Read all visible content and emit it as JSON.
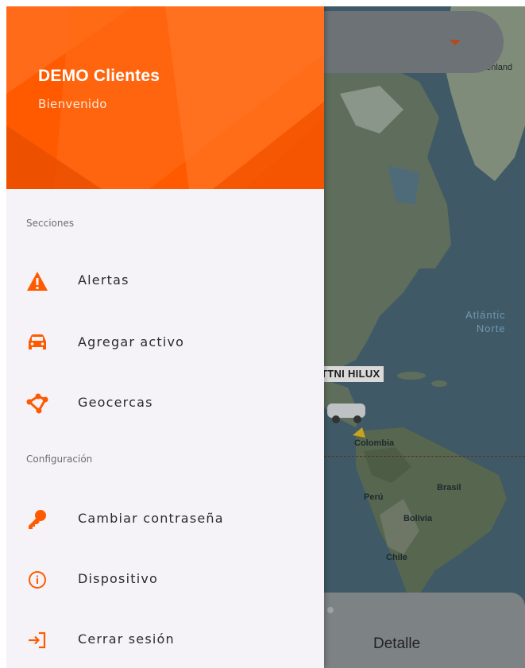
{
  "drawer": {
    "header": {
      "title": "DEMO  Clientes",
      "subtitle": "Bienvenido",
      "color": "#ff5a00"
    },
    "sections": [
      {
        "label": "Secciones",
        "items": [
          {
            "label": "Alertas",
            "icon": "warning-icon"
          },
          {
            "label": "Agregar  activo",
            "icon": "car-icon"
          },
          {
            "label": "Geocercas",
            "icon": "polygon-icon"
          }
        ]
      },
      {
        "label": "Configuración",
        "items": [
          {
            "label": "Cambiar  contraseña",
            "icon": "key-icon"
          },
          {
            "label": "Dispositivo",
            "icon": "info-icon"
          },
          {
            "label": "Cerrar  sesión",
            "icon": "logout-icon"
          }
        ]
      }
    ]
  },
  "map": {
    "greenland_label": "oenland",
    "ocean_label_line1": "Atlántic",
    "ocean_label_line2": "Norte",
    "vehicle_label": "TTNI HILUX",
    "place_labels": {
      "colombia": "Colombia",
      "brasil": "Brasil",
      "peru": "Perú",
      "bolivia": "Bolivia",
      "chile": "Chile"
    }
  },
  "bottom_sheet": {
    "detail_label": "Detalle"
  },
  "colors": {
    "accent": "#ff5a00",
    "icon": "#ff5a00",
    "drawer_bg": "#f5f3f7"
  }
}
